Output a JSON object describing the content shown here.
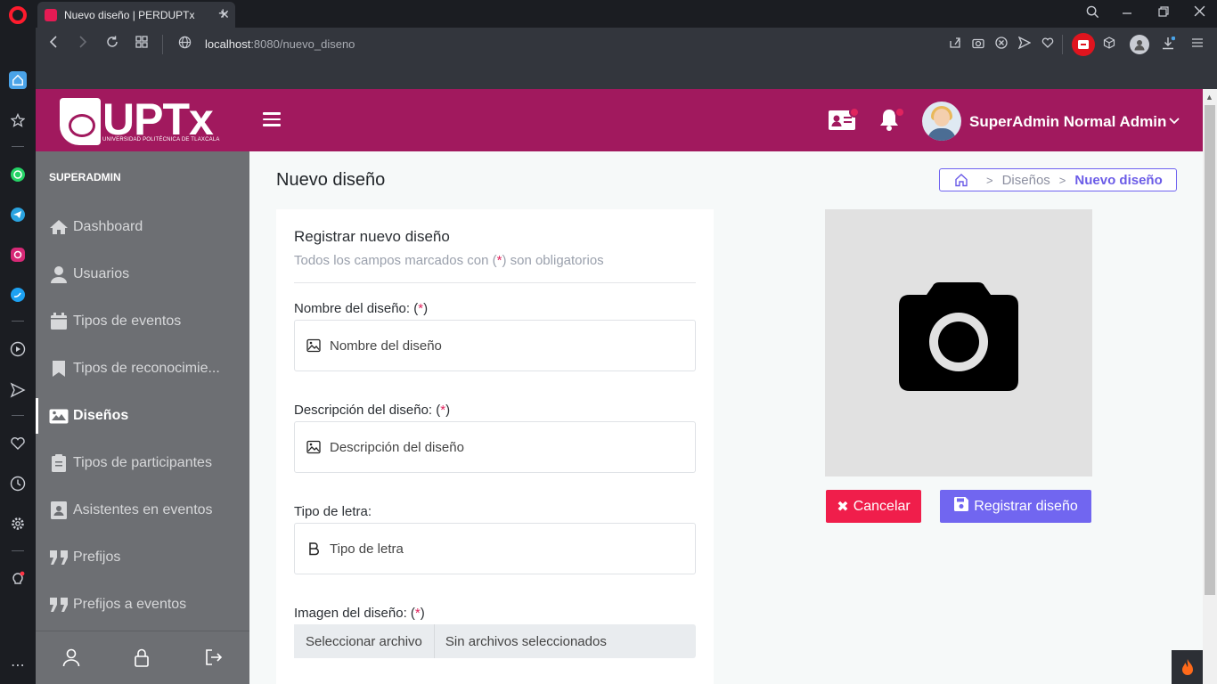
{
  "browser": {
    "tab_title": "Nuevo diseño | PERDUPTx",
    "tab_close": "✕",
    "new_tab": "+",
    "url_host": "localhost",
    "url_path": ":8080/nuevo_diseno"
  },
  "header": {
    "logo_text": "UPTx",
    "logo_subtitle": "UNIVERSIDAD POLITÉCNICA DE TLAXCALA",
    "user_name": "SuperAdmin Normal Admin",
    "brand_color": "#a1195e"
  },
  "sidebar": {
    "section": "SUPERADMIN",
    "items": [
      {
        "label": "Dashboard",
        "icon": "home-icon"
      },
      {
        "label": "Usuarios",
        "icon": "user-icon"
      },
      {
        "label": "Tipos de eventos",
        "icon": "calendar-icon"
      },
      {
        "label": "Tipos de reconocimie...",
        "icon": "bookmark-icon"
      },
      {
        "label": "Diseños",
        "icon": "image-icon",
        "active": true
      },
      {
        "label": "Tipos de participantes",
        "icon": "clipboard-icon"
      },
      {
        "label": "Asistentes en eventos",
        "icon": "id-card-icon"
      },
      {
        "label": "Prefijos",
        "icon": "quote-icon"
      },
      {
        "label": "Prefijos a eventos",
        "icon": "quote-icon"
      }
    ]
  },
  "page": {
    "title": "Nuevo diseño",
    "breadcrumb": {
      "parent": "Diseños",
      "current": "Nuevo diseño"
    }
  },
  "form": {
    "title": "Registrar nuevo diseño",
    "subtitle_before": "Todos los campos marcados con (",
    "subtitle_star": "*",
    "subtitle_after": ") son obligatorios",
    "name_label": "Nombre del diseño: (",
    "name_placeholder": "Nombre del diseño",
    "desc_label": "Descripción del diseño: (",
    "desc_placeholder": "Descripción del diseño",
    "font_label": "Tipo de letra:",
    "font_placeholder": "Tipo de letra",
    "image_label": "Imagen del diseño: (",
    "file_button": "Seleccionar archivo",
    "file_status": "Sin archivos seleccionados",
    "star": "*",
    "close_paren": ")"
  },
  "actions": {
    "cancel": "Cancelar",
    "cancel_icon": "✖",
    "save": "Registrar diseño",
    "cancel_color": "#f01e4b",
    "save_color": "#7166f0"
  }
}
